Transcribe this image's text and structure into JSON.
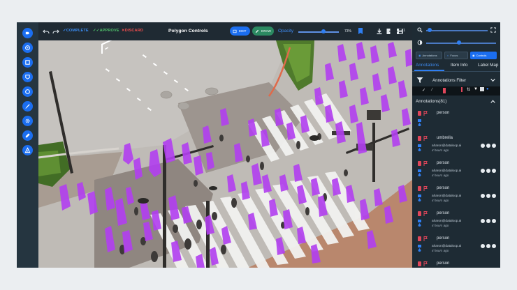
{
  "toolbar": {
    "complete_label": "COMPLETE",
    "approve_label": "APPROVE",
    "discard_label": "DISCARD",
    "title": "Polygon Controls",
    "edit_label": "EDIT",
    "draw_label": "DRAW",
    "opacity_label": "Opacity",
    "opacity_value": "73%",
    "item_count": "1"
  },
  "panel": {
    "tabs": [
      {
        "label": "Annotations"
      },
      {
        "label": "Item Info"
      },
      {
        "label": "Label Map"
      }
    ],
    "view_buttons": [
      {
        "label": "Annotations"
      },
      {
        "label": "Focus"
      },
      {
        "label": "Controls"
      }
    ],
    "filter_label": "Annotations Filter",
    "annotations_header": "Annotations(81)",
    "annotations": [
      {
        "label": "person",
        "user": "",
        "time": "",
        "color": "#e0465a"
      },
      {
        "label": "umbrella",
        "user": "aharon@dataloop.ai",
        "time": "4 hours ago",
        "color": "#e0465a"
      },
      {
        "label": "person",
        "user": "aharon@dataloop.ai",
        "time": "4 hours ago",
        "color": "#e0465a"
      },
      {
        "label": "person",
        "user": "aharon@dataloop.ai",
        "time": "4 hours ago",
        "color": "#e0465a"
      },
      {
        "label": "person",
        "user": "aharon@dataloop.ai",
        "time": "4 hours ago",
        "color": "#e0465a"
      },
      {
        "label": "person",
        "user": "aharon@dataloop.ai",
        "time": "4 hours ago",
        "color": "#e0465a"
      },
      {
        "label": "person",
        "user": "aharon@dataloop.ai",
        "time": "4 hours ago",
        "color": "#e0465a"
      }
    ]
  },
  "colors": {
    "accent": "#1b6ef0",
    "complete": "#3a8df5",
    "approve": "#4fc06a",
    "discard": "#ef4d4d",
    "mask": "#b23ff0",
    "panel_bg": "#1e2b34",
    "annotation_red": "#e0465a"
  },
  "icons": {
    "rail": [
      "label-icon",
      "target-icon",
      "box-icon",
      "polygon-icon",
      "circle-icon",
      "brush-icon",
      "gear-icon",
      "eyedropper-icon",
      "ai-assist-icon"
    ],
    "toolbar": [
      "undo-icon",
      "redo-icon",
      "download-icon",
      "export-icon",
      "upload-icon",
      "save-icon"
    ]
  }
}
